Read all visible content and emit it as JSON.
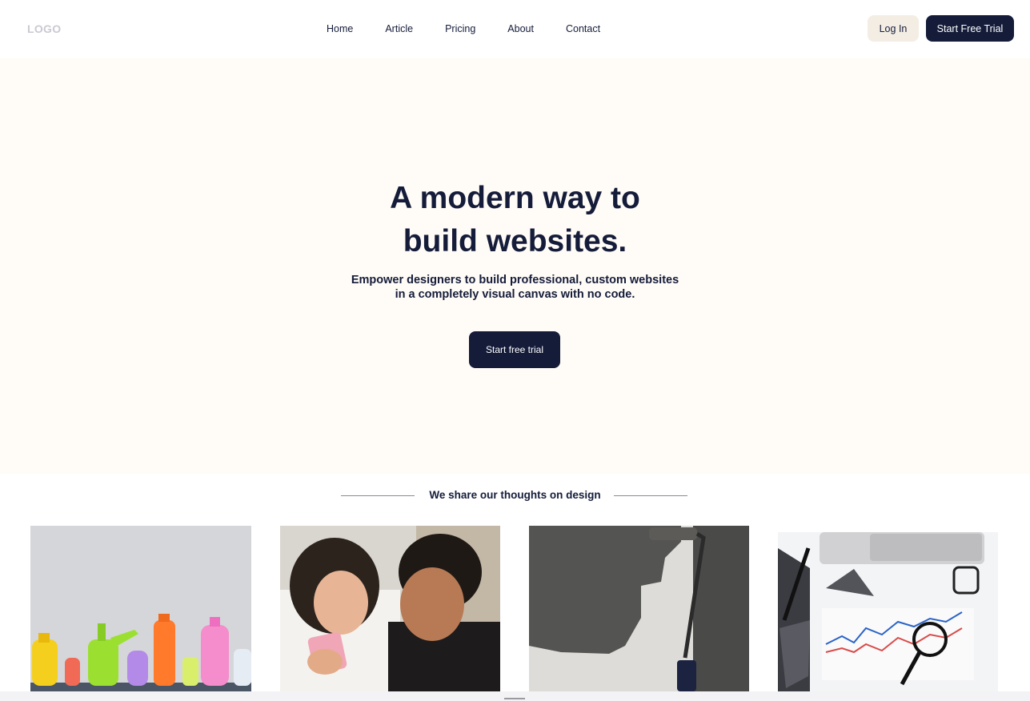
{
  "nav": {
    "logo": "LOGO",
    "links": [
      "Home",
      "Article",
      "Pricing",
      "About",
      "Contact"
    ],
    "login_label": "Log In",
    "trial_label": "Start Free Trial"
  },
  "hero": {
    "title_line1": "A modern way to",
    "title_line2": "build websites.",
    "subtitle_line1": "Empower designers to build professional, custom websites",
    "subtitle_line2": "in a completely visual canvas with no code.",
    "cta_label": "Start free trial"
  },
  "section": {
    "title": "We share our thoughts on design"
  },
  "cards": [
    {
      "image": "colorful-bottles-photo"
    },
    {
      "image": "friends-phone-photo"
    },
    {
      "image": "paint-roller-photo"
    },
    {
      "image": "analytics-desk-photo"
    }
  ],
  "colors": {
    "navy": "#141c3a",
    "hero_bg": "#fffbf6",
    "login_bg": "#f4ede4",
    "logo": "#c9c9d2"
  }
}
